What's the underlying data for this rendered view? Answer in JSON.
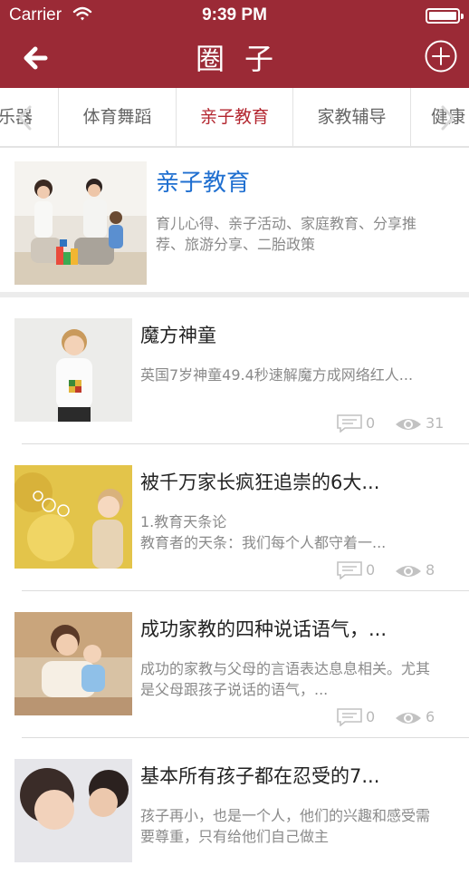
{
  "status_bar": {
    "carrier": "Carrier",
    "time": "9:39 PM"
  },
  "header": {
    "title": "圈子",
    "back_icon": "back-arrow-icon",
    "add_icon": "plus-circle-icon",
    "color": "#9b2a36"
  },
  "tabs": [
    {
      "label": "乐器"
    },
    {
      "label": "体育舞蹈"
    },
    {
      "label": "亲子教育",
      "active": true
    },
    {
      "label": "家教辅导"
    },
    {
      "label": "健康"
    }
  ],
  "featured": {
    "title": "亲子教育",
    "description": "育儿心得、亲子活动、家庭教育、分享推荐、旅游分享、二胎政策"
  },
  "articles": [
    {
      "title": "魔方神童",
      "excerpt": "英国7岁神童49.4秒速解魔方成网络红人...",
      "comments": "0",
      "views": "31"
    },
    {
      "title": "被千万家长疯狂追崇的6大...",
      "excerpt": "1.教育天条论\n教育者的天条：我们每个人都守着一...",
      "comments": "0",
      "views": "8"
    },
    {
      "title": "成功家教的四种说话语气，...",
      "excerpt": "成功的家教与父母的言语表达息息相关。尤其是父母跟孩子说话的语气，...",
      "comments": "0",
      "views": "6"
    },
    {
      "title": "基本所有孩子都在忍受的7...",
      "excerpt": "孩子再小，也是一个人，他们的兴趣和感受需要尊重，只有给他们自己做主",
      "comments": "",
      "views": ""
    }
  ]
}
